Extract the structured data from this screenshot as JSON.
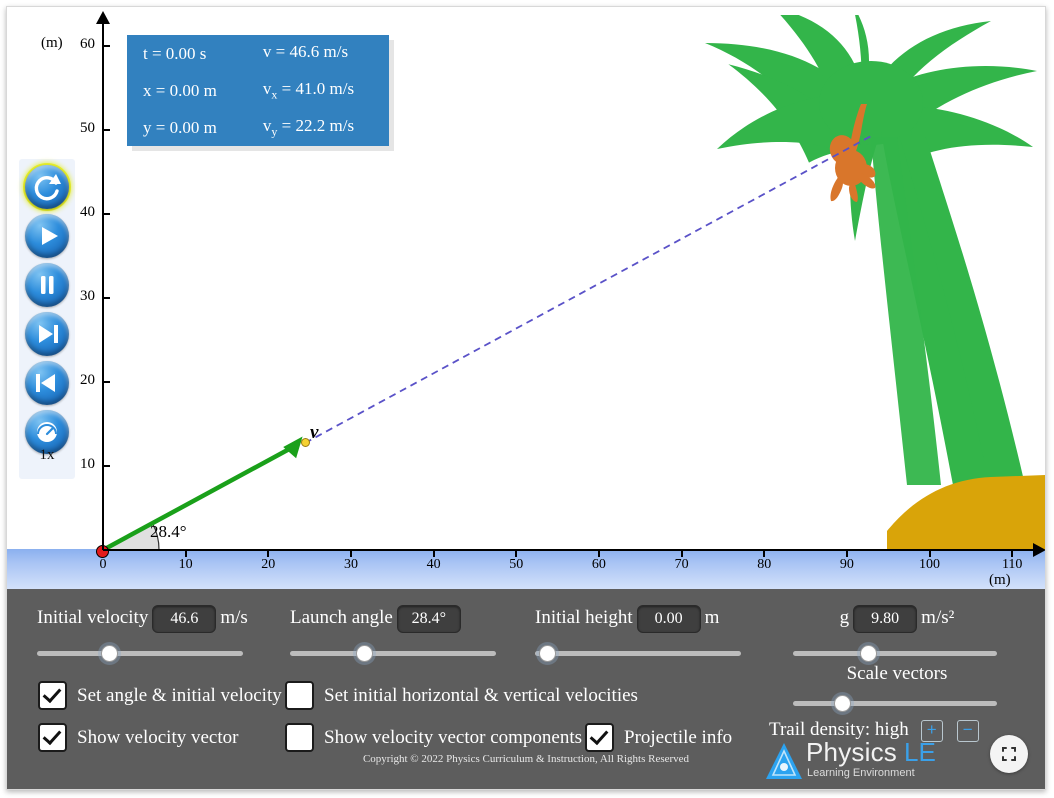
{
  "info_panel": {
    "rows": [
      {
        "left": "t = 0.00 s",
        "right_pre": "v",
        "right_sub": "",
        "right_post": " = 46.6 m/s"
      },
      {
        "left": "x = 0.00 m",
        "right_pre": "v",
        "right_sub": "x",
        "right_post": " = 41.0 m/s"
      },
      {
        "left": "y = 0.00 m",
        "right_pre": "v",
        "right_sub": "y",
        "right_post": " = 22.2 m/s"
      }
    ],
    "background_color": "#3281bf"
  },
  "axes": {
    "y_unit": "(m)",
    "x_unit": "(m)",
    "y_ticks": [
      "60",
      "50",
      "40",
      "30",
      "20",
      "10"
    ],
    "x_ticks": [
      "0",
      "10",
      "20",
      "30",
      "40",
      "50",
      "60",
      "70",
      "80",
      "90",
      "100",
      "110"
    ],
    "y_min": 0,
    "y_max": 63,
    "x_min": 0,
    "x_max": 113
  },
  "stage": {
    "angle_label": "28.4°",
    "vector_label": "v",
    "vector_color": "#1aa01a",
    "trajectory_color": "#5a52c8",
    "projectile_color": "#e41b1b",
    "tree_color": "#33b54a",
    "monkey_color": "#d9762b",
    "hill_color": "#d9a409",
    "ground_color": "#8bb0ef"
  },
  "playback": {
    "buttons": [
      {
        "name": "reset",
        "selected": true
      },
      {
        "name": "play",
        "selected": false
      },
      {
        "name": "pause",
        "selected": false
      },
      {
        "name": "step-forward",
        "selected": false
      },
      {
        "name": "step-back",
        "selected": false
      },
      {
        "name": "speed",
        "selected": false
      }
    ],
    "speed_label": "1x"
  },
  "controls": {
    "initial_velocity": {
      "label": "Initial velocity",
      "value": "46.6",
      "unit": "m/s",
      "slider_pct": 31
    },
    "launch_angle": {
      "label": "Launch angle",
      "value": "28.4°",
      "unit": "",
      "slider_pct": 32
    },
    "initial_height": {
      "label": "Initial height",
      "value": "0.00",
      "unit": "m",
      "slider_pct": 2
    },
    "gravity": {
      "label": "g",
      "value": "9.80",
      "unit": "m/s²",
      "slider_pct": 33
    },
    "scale_vectors": {
      "label": "Scale vectors",
      "slider_pct": 20
    },
    "checkboxes": [
      {
        "label": "Set angle & initial velocity",
        "checked": true
      },
      {
        "label": "Set initial horizontal & vertical velocities",
        "checked": false
      },
      {
        "label": "Show velocity vector",
        "checked": true
      },
      {
        "label": "Show velocity vector components",
        "checked": false
      },
      {
        "label": "Projectile info",
        "checked": true
      }
    ],
    "trail_density": {
      "label": "Trail density: high",
      "plus": "+",
      "minus": "−"
    }
  },
  "footer": {
    "copyright": "Copyright © 2022 Physics Curriculum & Instruction, All Rights Reserved",
    "logo_part1": "Physics",
    "logo_part2": "LE",
    "logo_tagline": "Learning Environment"
  }
}
